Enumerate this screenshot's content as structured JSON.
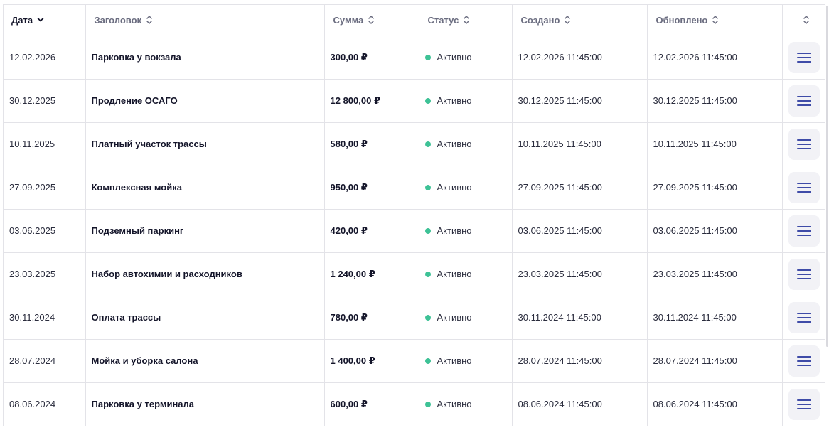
{
  "columns": [
    {
      "label": "Дата",
      "sort": "desc"
    },
    {
      "label": "Заголовок",
      "sort": "none"
    },
    {
      "label": "Сумма",
      "sort": "none"
    },
    {
      "label": "Статус",
      "sort": "none"
    },
    {
      "label": "Создано",
      "sort": "none"
    },
    {
      "label": "Обновлено",
      "sort": "none"
    },
    {
      "label": "",
      "sort": "none"
    }
  ],
  "status_color": "#3ec296",
  "menu_icon_color": "#3f4ca8",
  "rows": [
    {
      "date": "12.02.2026",
      "title": "Парковка у вокзала",
      "sum": "300,00 ₽",
      "status": "Активно",
      "created": "12.02.2026 11:45:00",
      "updated": "12.02.2026 11:45:00"
    },
    {
      "date": "30.12.2025",
      "title": "Продление ОСАГО",
      "sum": "12 800,00 ₽",
      "status": "Активно",
      "created": "30.12.2025 11:45:00",
      "updated": "30.12.2025 11:45:00"
    },
    {
      "date": "10.11.2025",
      "title": "Платный участок трассы",
      "sum": "580,00 ₽",
      "status": "Активно",
      "created": "10.11.2025 11:45:00",
      "updated": "10.11.2025 11:45:00"
    },
    {
      "date": "27.09.2025",
      "title": "Комплексная мойка",
      "sum": "950,00 ₽",
      "status": "Активно",
      "created": "27.09.2025 11:45:00",
      "updated": "27.09.2025 11:45:00"
    },
    {
      "date": "03.06.2025",
      "title": "Подземный паркинг",
      "sum": "420,00 ₽",
      "status": "Активно",
      "created": "03.06.2025 11:45:00",
      "updated": "03.06.2025 11:45:00"
    },
    {
      "date": "23.03.2025",
      "title": "Набор автохимии и расходников",
      "sum": "1 240,00 ₽",
      "status": "Активно",
      "created": "23.03.2025 11:45:00",
      "updated": "23.03.2025 11:45:00"
    },
    {
      "date": "30.11.2024",
      "title": "Оплата трассы",
      "sum": "780,00 ₽",
      "status": "Активно",
      "created": "30.11.2024 11:45:00",
      "updated": "30.11.2024 11:45:00"
    },
    {
      "date": "28.07.2024",
      "title": "Мойка и уборка салона",
      "sum": "1 400,00 ₽",
      "status": "Активно",
      "created": "28.07.2024 11:45:00",
      "updated": "28.07.2024 11:45:00"
    },
    {
      "date": "08.06.2024",
      "title": "Парковка у терминала",
      "sum": "600,00 ₽",
      "status": "Активно",
      "created": "08.06.2024 11:45:00",
      "updated": "08.06.2024 11:45:00"
    }
  ]
}
